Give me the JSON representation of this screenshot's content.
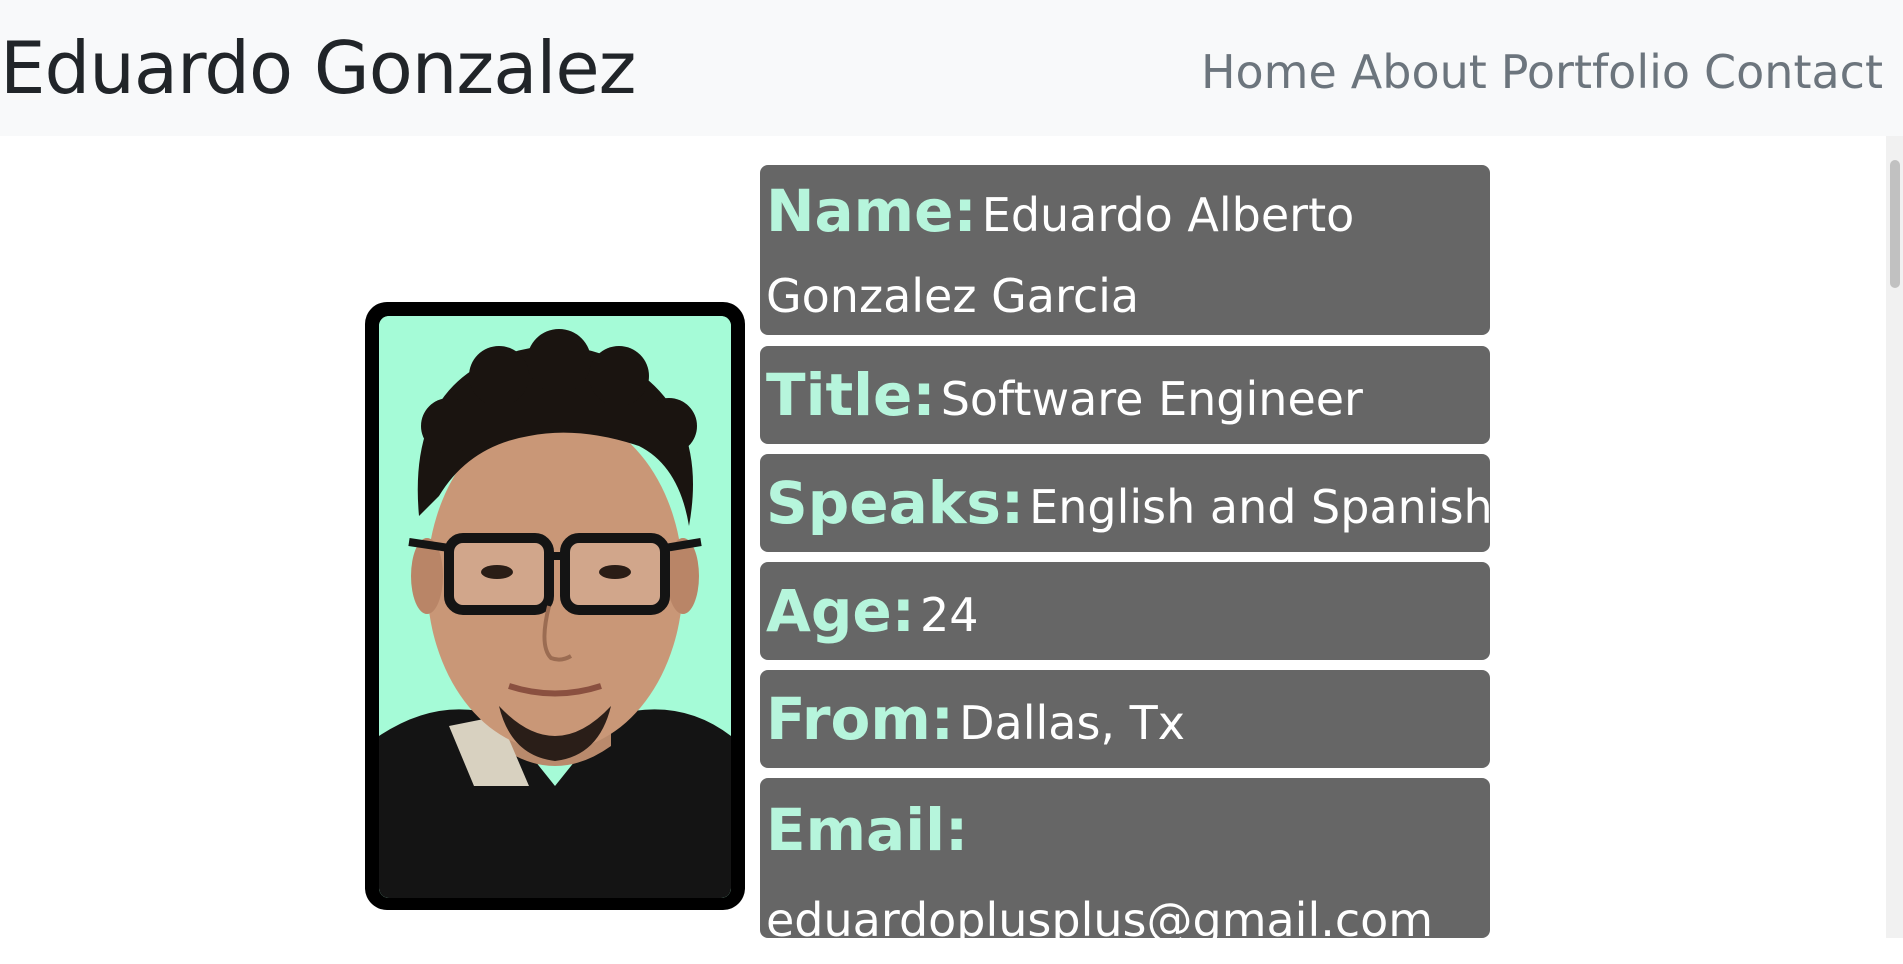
{
  "header": {
    "brand": "Eduardo Gonzalez",
    "nav": [
      {
        "label": "Home"
      },
      {
        "label": "About"
      },
      {
        "label": "Portfolio"
      },
      {
        "label": "Contact"
      }
    ]
  },
  "profile": {
    "photo_alt": "Portrait of Eduardo Gonzalez",
    "accent_color": "#a5fbd7",
    "fields": {
      "name": {
        "label": "Name:",
        "value_line1": "Eduardo Alberto",
        "value_line2": "Gonzalez Garcia"
      },
      "title": {
        "label": "Title:",
        "value": "Software Engineer"
      },
      "speaks": {
        "label": "Speaks:",
        "value": "English and Spanish"
      },
      "age": {
        "label": "Age:",
        "value": "24"
      },
      "from": {
        "label": "From:",
        "value": "Dallas, Tx"
      },
      "email": {
        "label": "Email:",
        "value": "eduardoplusplus@gmail.com"
      }
    }
  }
}
